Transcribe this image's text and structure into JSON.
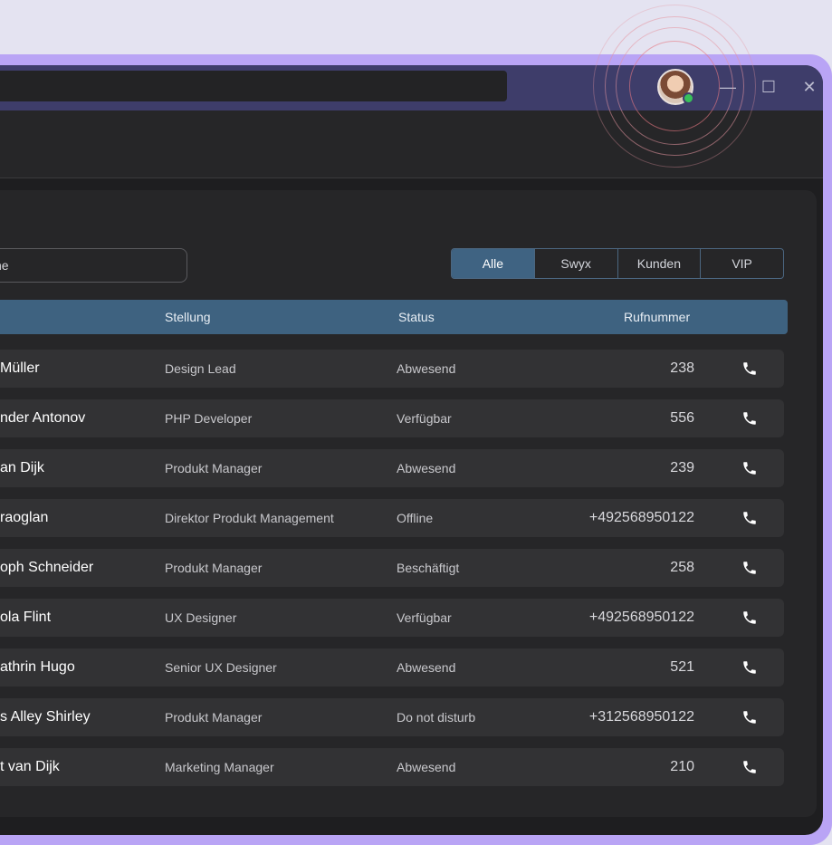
{
  "window": {
    "minimize_glyph": "—",
    "maximize_glyph": "☐",
    "close_glyph": "✕"
  },
  "user": {
    "avatar_icon": "user-avatar",
    "status_color": "#38c05a"
  },
  "search": {
    "placeholder": "che"
  },
  "filters": [
    "Alle",
    "Swyx",
    "Kunden",
    "VIP"
  ],
  "filters_active": "Alle",
  "table": {
    "headers": {
      "position": "Stellung",
      "status": "Status",
      "phone": "Rufnummer"
    },
    "rows": [
      {
        "name": "Müller",
        "position": "Design Lead",
        "status": "Abwesend",
        "phone": "238"
      },
      {
        "name": "nder Antonov",
        "position": "PHP Developer",
        "status": "Verfügbar",
        "phone": "556"
      },
      {
        "name": "an Dijk",
        "position": "Produkt Manager",
        "status": "Abwesend",
        "phone": "239"
      },
      {
        "name": "raoglan",
        "position": "Direktor Produkt Management",
        "status": "Offline",
        "phone": "+492568950122"
      },
      {
        "name": "oph Schneider",
        "position": "Produkt Manager",
        "status": "Beschäftigt",
        "phone": "258"
      },
      {
        "name": "ola Flint",
        "position": "UX Designer",
        "status": "Verfügbar",
        "phone": "+492568950122"
      },
      {
        "name": "athrin Hugo",
        "position": "Senior UX Designer",
        "status": "Abwesend",
        "phone": "521"
      },
      {
        "name": "s Alley Shirley",
        "position": "Produkt Manager",
        "status": "Do not disturb",
        "phone": "+312568950122"
      },
      {
        "name": "t van Dijk",
        "position": "Marketing Manager",
        "status": "Abwesend",
        "phone": "210"
      }
    ]
  },
  "colors": {
    "accent": "#3f6382",
    "frame": "#b9a4f5",
    "titlebar": "#3e3d6a"
  }
}
